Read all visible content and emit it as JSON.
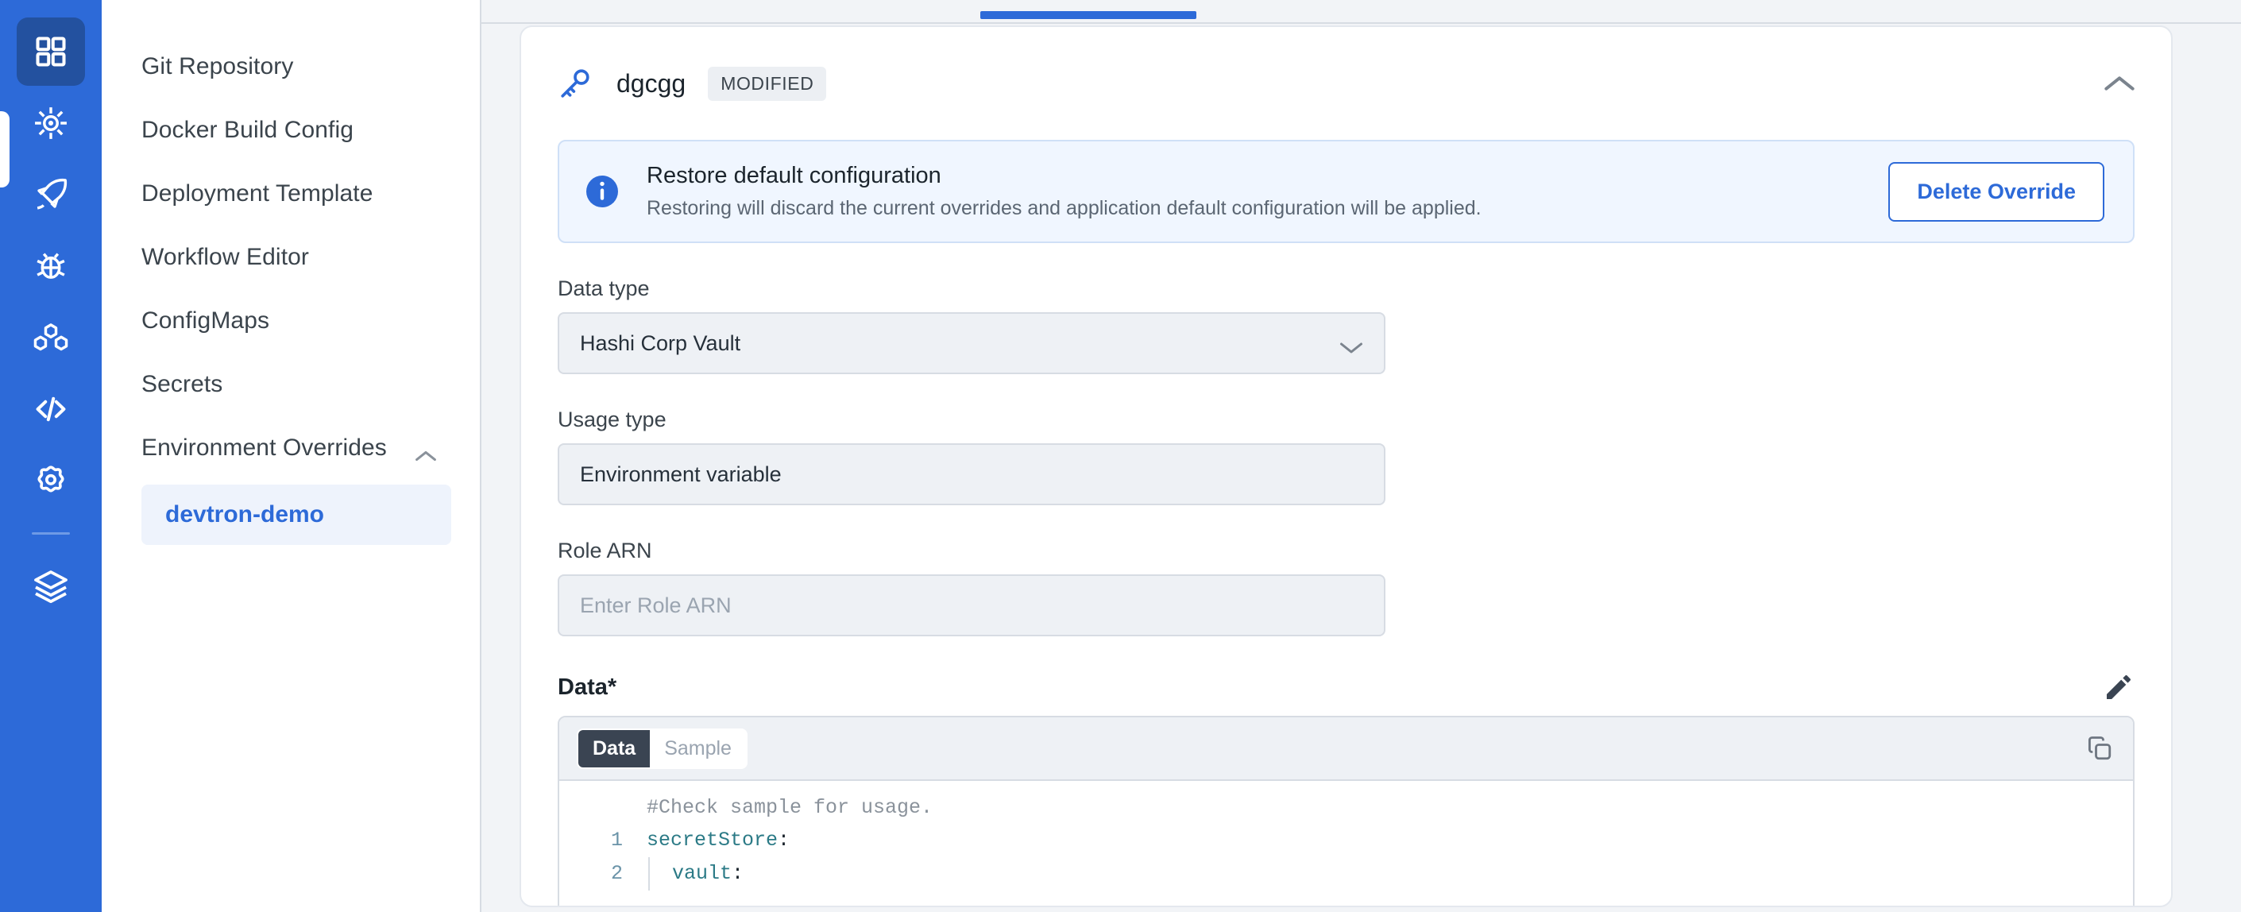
{
  "rail": {
    "items": [
      {
        "name": "apps-grid-icon",
        "label": "Applications",
        "active": true
      },
      {
        "name": "helm-chart-icon",
        "label": "Chart Store",
        "active": false
      },
      {
        "name": "rocket-icon",
        "label": "Deployments",
        "active": false
      },
      {
        "name": "bug-icon",
        "label": "Security",
        "active": false
      },
      {
        "name": "clusters-icon",
        "label": "Clusters",
        "active": false
      },
      {
        "name": "code-icon",
        "label": "Code",
        "active": false
      },
      {
        "name": "gear-icon",
        "label": "Global Configurations",
        "active": false
      },
      {
        "name": "stack-icon",
        "label": "Stack Manager",
        "active": false
      }
    ]
  },
  "nav": {
    "items": [
      {
        "label": "Git Repository"
      },
      {
        "label": "Docker Build Config"
      },
      {
        "label": "Deployment Template"
      },
      {
        "label": "Workflow Editor"
      },
      {
        "label": "ConfigMaps"
      },
      {
        "label": "Secrets"
      }
    ],
    "group": {
      "label": "Environment Overrides",
      "expanded": true,
      "children": [
        {
          "label": "devtron-demo",
          "selected": true
        }
      ]
    }
  },
  "card": {
    "icon": "key-icon",
    "title": "dgcgg",
    "badge": "MODIFIED",
    "collapse_icon": "chevron-up-icon"
  },
  "banner": {
    "icon": "info-icon",
    "title": "Restore default configuration",
    "subtitle": "Restoring will discard the current overrides and application default configuration will be applied.",
    "button": "Delete Override"
  },
  "form": {
    "data_type": {
      "label": "Data type",
      "value": "Hashi Corp Vault",
      "icon": "chevron-down-icon"
    },
    "usage_type": {
      "label": "Usage type",
      "value": "Environment variable"
    },
    "role_arn": {
      "label": "Role ARN",
      "value": "",
      "placeholder": "Enter Role ARN"
    }
  },
  "data_section": {
    "label": "Data*",
    "edit_icon": "pencil-icon",
    "tabs": [
      {
        "label": "Data",
        "active": true
      },
      {
        "label": "Sample",
        "active": false
      }
    ],
    "copy_icon": "copy-icon",
    "comment": "#Check sample for usage.",
    "lines": [
      {
        "number": "1",
        "key": "secretStore",
        "punct": ":",
        "indented": false
      },
      {
        "number": "2",
        "key": "vault",
        "punct": ":",
        "indented": true
      }
    ]
  },
  "colors": {
    "rail_bg": "#2d6ad8",
    "accent": "#2d6ad8",
    "content_bg": "#f2f4f7",
    "banner_bg": "#f0f6ff",
    "field_bg": "#eef1f5",
    "yaml_key": "#2b7a86"
  }
}
